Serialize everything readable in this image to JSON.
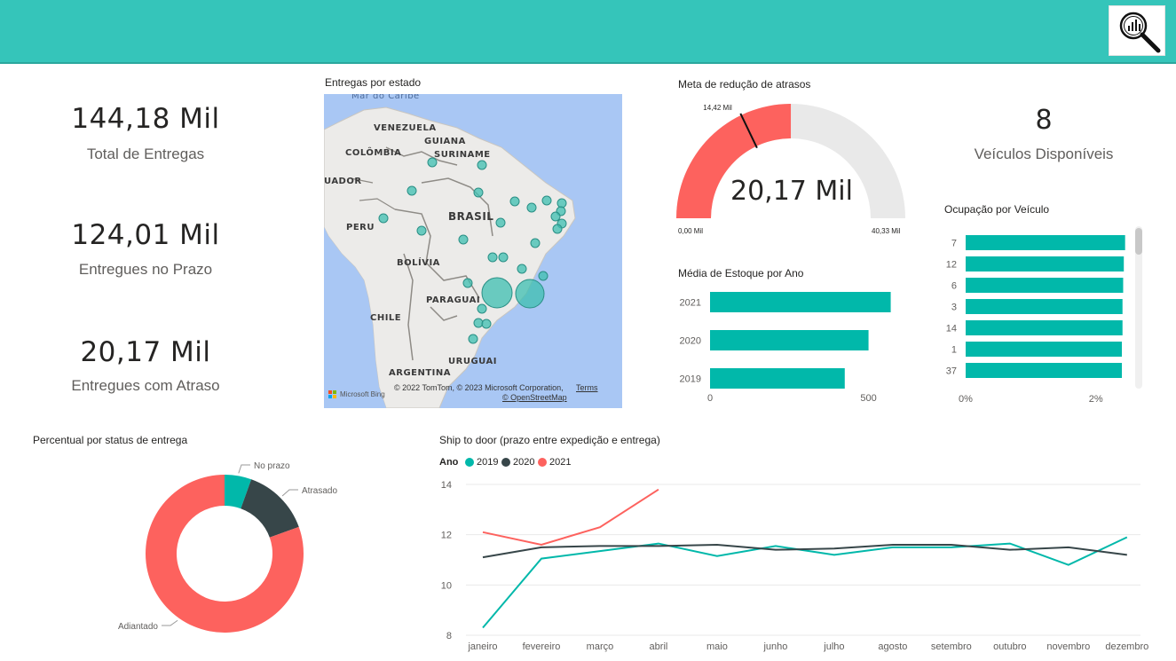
{
  "header": {
    "bg_color": "#35c5ba",
    "logo_icon": "magnifier-chart-icon"
  },
  "kpis": {
    "total": {
      "value": "144,18 Mil",
      "label": "Total de Entregas"
    },
    "on_time": {
      "value": "124,01 Mil",
      "label": "Entregues no Prazo"
    },
    "late": {
      "value": "20,17 Mil",
      "label": "Entregues com Atraso"
    },
    "vehicles": {
      "value": "8",
      "label": "Veículos Disponíveis"
    }
  },
  "map": {
    "title": "Entregas por estado",
    "labels": [
      "Mar do Caribe",
      "VENEZUELA",
      "GUIANA",
      "COLÔMBIA",
      "SURINAME",
      "UADOR",
      "BRASIL",
      "PERU",
      "BOLÍVIA",
      "PARAGUAI",
      "CHILE",
      "URUGUAI",
      "ARGENTINA"
    ],
    "copyright": "© 2022 TomTom, © 2023 Microsoft Corporation,",
    "terms": "Terms",
    "osm": "© OpenStreetMap",
    "bing": "Microsoft Bing",
    "bubble_color": "#3dbfb0"
  },
  "gauge": {
    "title": "Meta de redução de atrasos",
    "value": "20,17 Mil",
    "target_label": "14,42 Mil",
    "min_label": "0,00 Mil",
    "max_label": "40,33 Mil",
    "value_num": 20.17,
    "target_num": 14.42,
    "min_num": 0,
    "max_num": 40.33,
    "fill_color": "#fd625e",
    "track_color": "#e9e9e9"
  },
  "stock": {
    "title": "Média de Estoque por Ano",
    "chart_data": {
      "type": "bar",
      "orientation": "horizontal",
      "categories": [
        "2021",
        "2020",
        "2019"
      ],
      "values": [
        570,
        500,
        425
      ],
      "xticks": [
        "0",
        "500"
      ],
      "xlim": [
        0,
        700
      ],
      "color": "#01b8aa"
    }
  },
  "occupancy": {
    "title": "Ocupação por Veículo",
    "chart_data": {
      "type": "bar",
      "orientation": "horizontal",
      "categories": [
        "7",
        "12",
        "6",
        "3",
        "14",
        "1",
        "37"
      ],
      "values": [
        2.45,
        2.43,
        2.42,
        2.41,
        2.41,
        2.4,
        2.4
      ],
      "xticks": [
        "0%",
        "2%"
      ],
      "xlim": [
        0,
        3
      ],
      "color": "#01b8aa"
    }
  },
  "donut": {
    "title": "Percentual por status de entrega",
    "chart_data": {
      "type": "pie",
      "labels": [
        "No prazo",
        "Atrasado",
        "Adiantado"
      ],
      "values": [
        5.5,
        14,
        80.5
      ],
      "colors": [
        "#01b8aa",
        "#374649",
        "#fd625e"
      ]
    }
  },
  "line": {
    "title": "Ship to door (prazo entre expedição e entrega)",
    "legend_title": "Ano",
    "chart_data": {
      "type": "line",
      "categories": [
        "janeiro",
        "fevereiro",
        "março",
        "abril",
        "maio",
        "junho",
        "julho",
        "agosto",
        "setembro",
        "outubro",
        "novembro",
        "dezembro"
      ],
      "series": [
        {
          "name": "2019",
          "color": "#01b8aa",
          "values": [
            8.3,
            11.05,
            11.35,
            11.65,
            11.15,
            11.55,
            11.2,
            11.5,
            11.5,
            11.65,
            10.8,
            11.9
          ]
        },
        {
          "name": "2020",
          "color": "#374649",
          "values": [
            11.1,
            11.5,
            11.55,
            11.55,
            11.6,
            11.4,
            11.45,
            11.6,
            11.6,
            11.4,
            11.5,
            11.2
          ]
        },
        {
          "name": "2021",
          "color": "#fd625e",
          "values": [
            12.1,
            11.6,
            12.3,
            13.8
          ]
        }
      ],
      "yticks": [
        "14",
        "12",
        "10",
        "8"
      ],
      "ylim": [
        8,
        14
      ]
    }
  }
}
